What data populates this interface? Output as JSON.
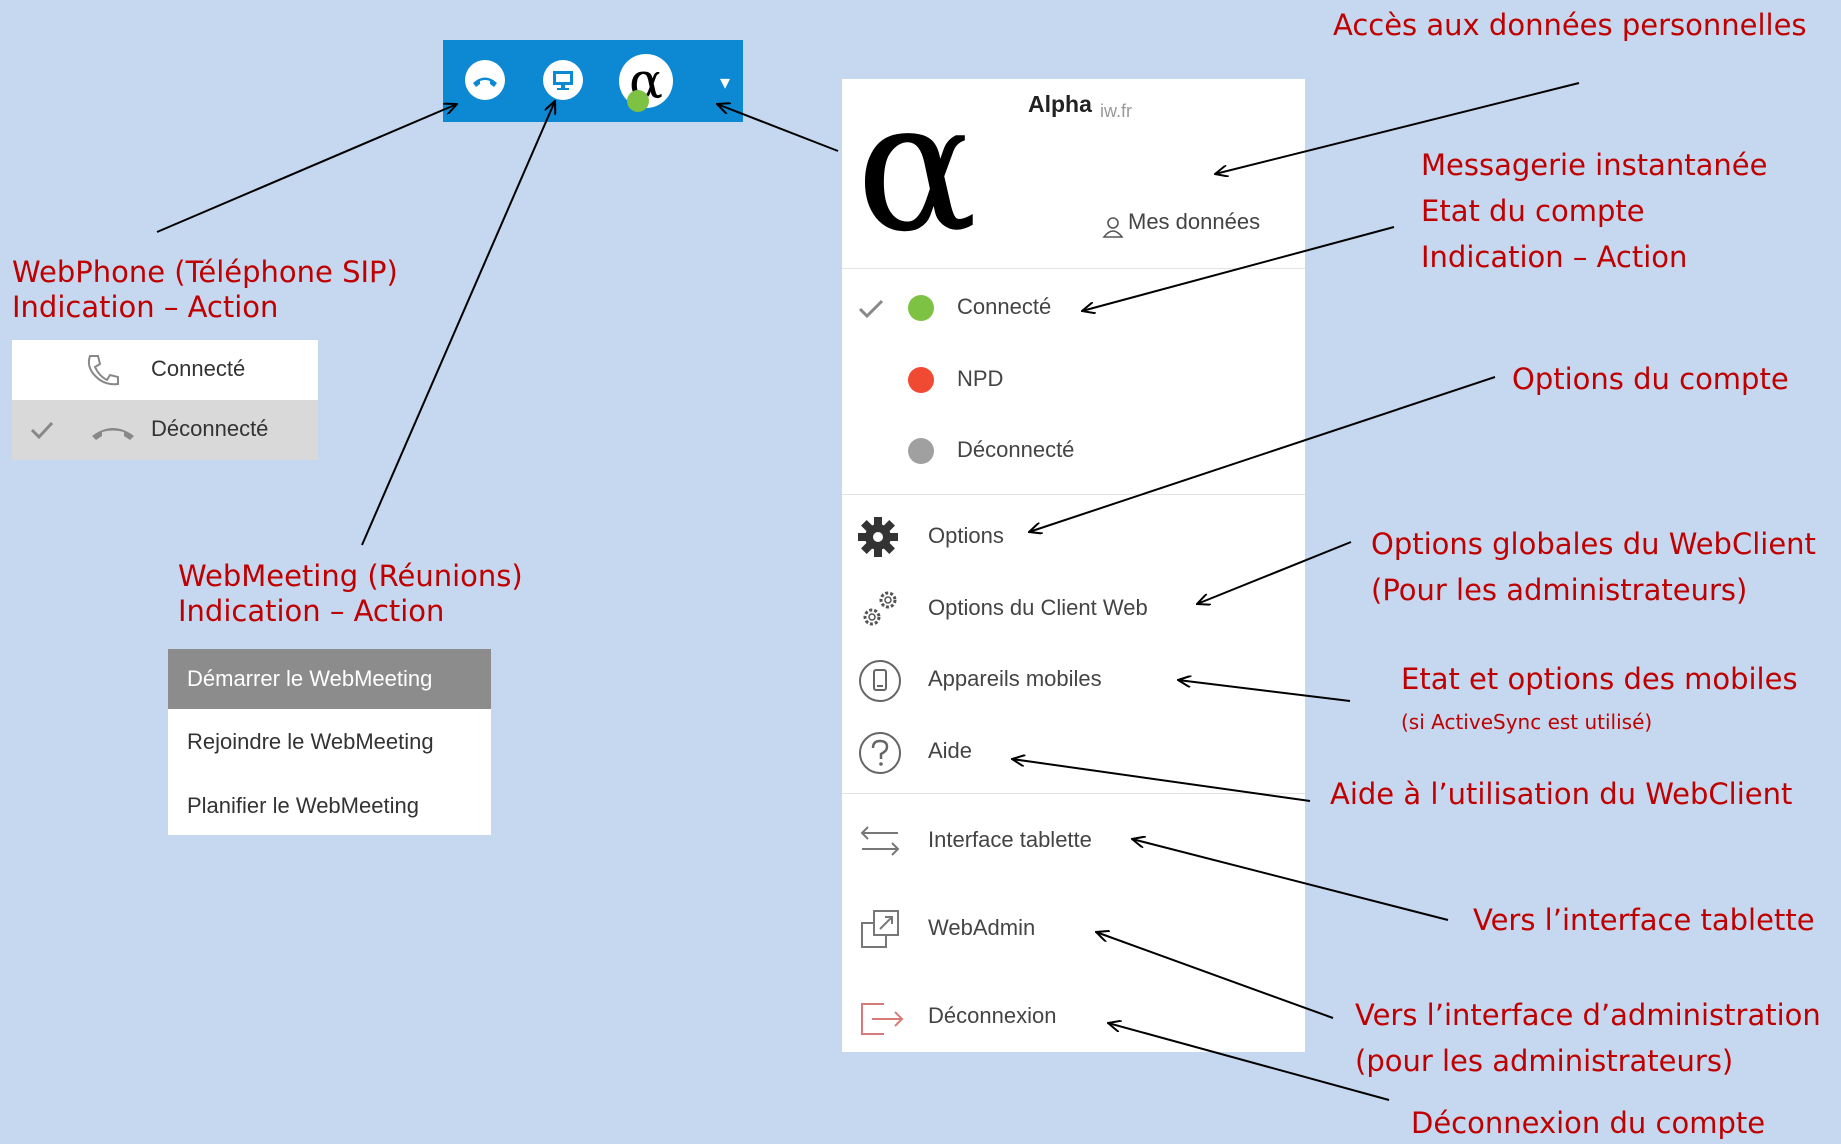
{
  "toolbar": {
    "avatar_glyph": "α",
    "caret": "▾",
    "accent": "#0d88d2",
    "status_color": "#7dc242"
  },
  "phone_popup": {
    "items": [
      {
        "label": "Connecté",
        "checked": false
      },
      {
        "label": "Déconnecté",
        "checked": true
      }
    ]
  },
  "meeting_popup": {
    "items": [
      "Démarrer le WebMeeting",
      "Rejoindre le WebMeeting",
      "Planifier le WebMeeting"
    ]
  },
  "menu": {
    "avatar_glyph": "α",
    "user_name": "Alpha",
    "domain": "iw.fr",
    "my_data": "Mes données",
    "statuses": [
      {
        "label": "Connecté",
        "color": "#7dc242",
        "checked": true
      },
      {
        "label": "NPD",
        "color": "#f04a32",
        "checked": false
      },
      {
        "label": "Déconnecté",
        "color": "#a0a0a0",
        "checked": false
      }
    ],
    "items": [
      {
        "label": "Options",
        "icon": "gear-icon"
      },
      {
        "label": "Options du Client Web",
        "icon": "gears-icon"
      },
      {
        "label": "Appareils mobiles",
        "icon": "mobile-icon"
      },
      {
        "label": "Aide",
        "icon": "help-icon"
      },
      {
        "label": "Interface tablette",
        "icon": "swap-arrows-icon"
      },
      {
        "label": "WebAdmin",
        "icon": "external-link-icon"
      },
      {
        "label": "Déconnexion",
        "icon": "logout-icon"
      }
    ]
  },
  "annotations": {
    "personal_data": "Accès aux données personnelles",
    "im_1": "Messagerie instantanée",
    "im_2": "Etat du compte",
    "im_3": "Indication – Action",
    "account_options": "Options du compte",
    "global_1": "Options globales du WebClient",
    "global_2": "(Pour les administrateurs)",
    "mobile_1": "Etat et options des mobiles",
    "mobile_2": "(si ActiveSync est utilisé)",
    "help": "Aide à l’utilisation du WebClient",
    "tablet": "Vers l’interface tablette",
    "admin_1": "Vers l’interface d’administration",
    "admin_2": "(pour les administrateurs)",
    "logout": "Déconnexion du compte",
    "webphone_1": "WebPhone (Téléphone SIP)",
    "webphone_2": "Indication – Action",
    "webmeeting_1": "WebMeeting (Réunions)",
    "webmeeting_2": "Indication – Action"
  }
}
